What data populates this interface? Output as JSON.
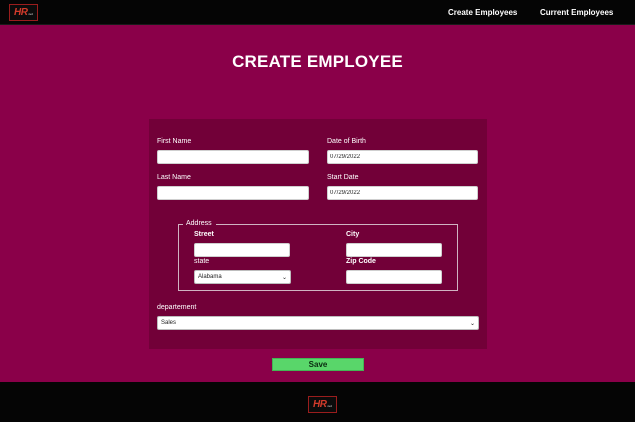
{
  "brand": {
    "logo_main": "HR",
    "logo_sub": "net",
    "brand_color": "#d23b2b"
  },
  "nav": {
    "create_label": "Create Employees",
    "current_label": "Current Employees"
  },
  "page": {
    "title": "CREATE EMPLOYEE",
    "background": "#8a0049",
    "panel_color": "#720038"
  },
  "form": {
    "first_name_label": "First Name",
    "first_name_value": "",
    "dob_label": "Date of Birth",
    "dob_value": "07/29/2022",
    "last_name_label": "Last Name",
    "last_name_value": "",
    "start_date_label": "Start Date",
    "start_date_value": "07/29/2022",
    "address": {
      "legend": "Address",
      "street_label": "Street",
      "street_value": "",
      "city_label": "City",
      "city_value": "",
      "state_label": "state",
      "state_selected": "Alabama",
      "zip_label": "Zip Code",
      "zip_value": ""
    },
    "department_label": "departement",
    "department_selected": "Sales",
    "save_label": "Save",
    "save_color": "#59d66a"
  },
  "icons": {
    "dropdown": "chevron-down-icon"
  }
}
